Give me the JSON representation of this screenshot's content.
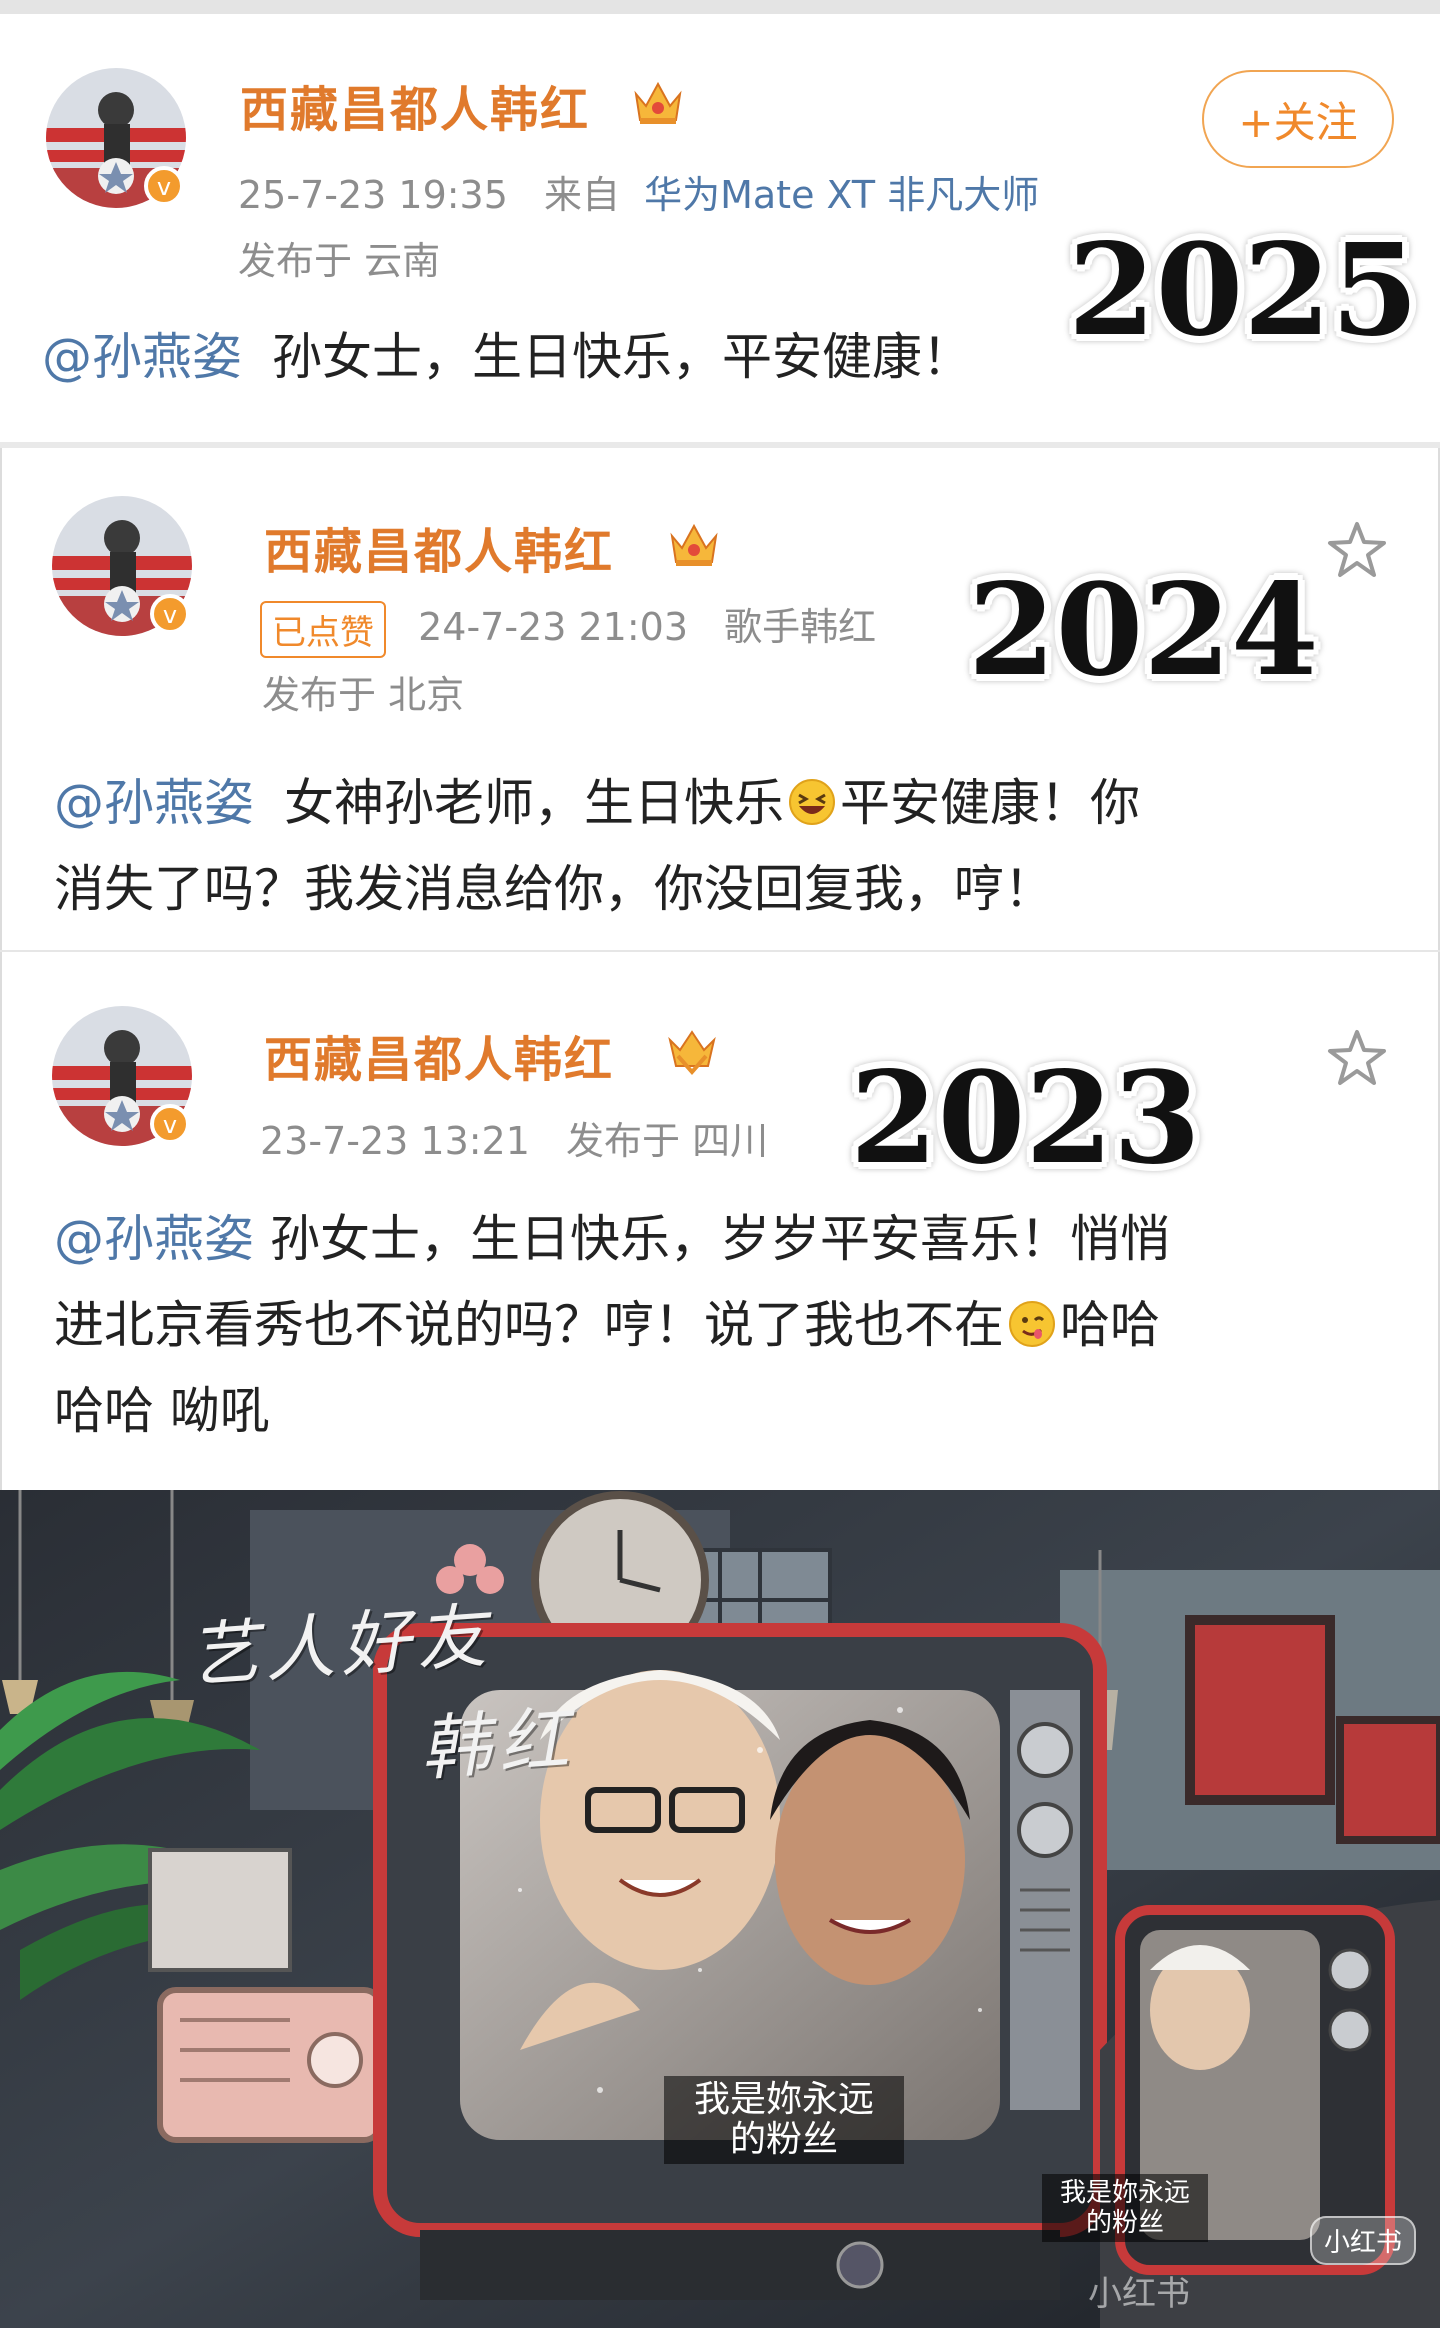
{
  "posts": [
    {
      "username": "西藏昌都人韩红",
      "timestamp": "25-7-23 19:35",
      "source_prefix": "来自",
      "source": "华为Mate XT 非凡大师",
      "location": "发布于 云南",
      "mention": "@孙燕姿",
      "text_lines": [
        "孙女士，生日快乐，平安健康！"
      ],
      "follow_label": "+关注",
      "year": "2025"
    },
    {
      "username": "西藏昌都人韩红",
      "liked_label": "已点赞",
      "timestamp": "24-7-23 21:03",
      "source": "歌手韩红",
      "location": "发布于 北京",
      "mention": "@孙燕姿",
      "text_part1": "女神孙老师，生日快乐",
      "text_part2": "平安健康！你",
      "text_line2": "消失了吗？我发消息给你，你没回复我，哼！",
      "year": "2024"
    },
    {
      "username": "西藏昌都人韩红",
      "timestamp": "23-7-23 13:21",
      "location": "发布于 四川",
      "mention": "@孙燕姿",
      "text_line1": "孙女士，生日快乐，岁岁平安喜乐！悄悄",
      "text_line2a": "进北京看秀也不说的吗？哼！说了我也不在",
      "text_line2b": "哈哈",
      "text_line3": "哈哈 呦吼",
      "year": "2023"
    }
  ],
  "photo": {
    "overlay_title_1": "艺人好友",
    "overlay_title_2": "韩红",
    "caption_main": "我是妳永远\n的粉丝",
    "caption_small": "我是妳永远\n的粉丝",
    "watermark_badge": "小红书",
    "watermark_text": "小红书"
  },
  "colors": {
    "username": "#e07a2c",
    "mention": "#4f78a8",
    "meta": "#8d8d8d",
    "follow": "#f0892b"
  },
  "icons": [
    "avatar",
    "crown-icon",
    "verified-icon",
    "star-icon",
    "laughing-emoji",
    "drooling-emoji"
  ]
}
